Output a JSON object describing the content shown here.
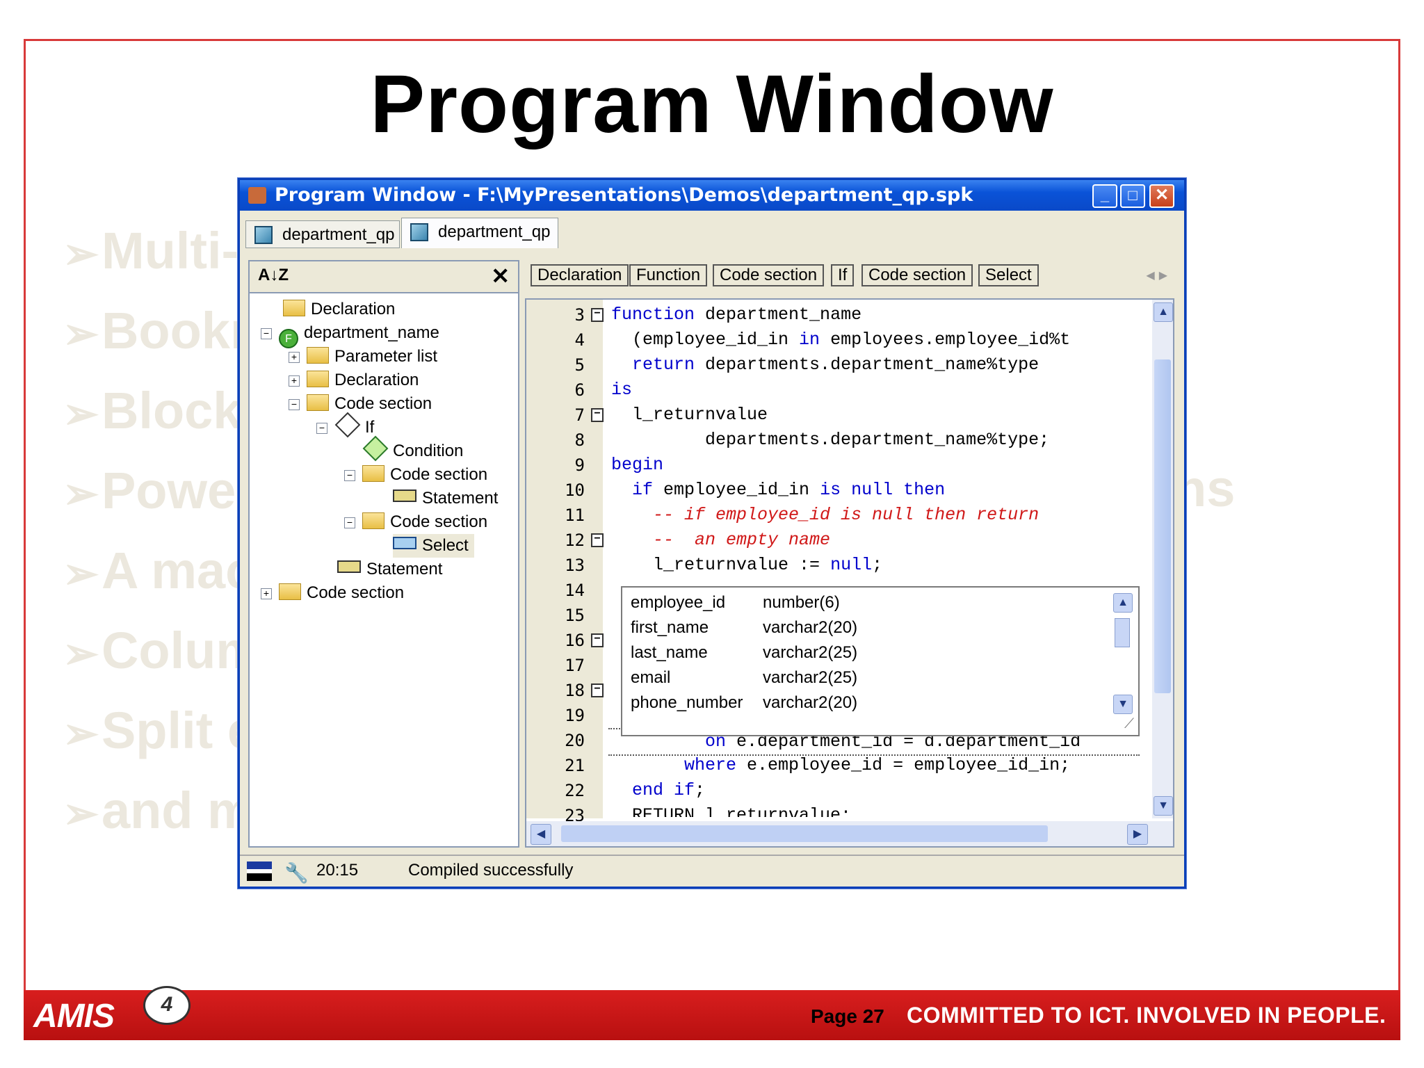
{
  "slide": {
    "title": "Program Window",
    "bullets": [
      "Multi-",
      "Bookm",
      "Block",
      "Power",
      "A mac",
      "Colum",
      "Split e",
      "and m"
    ],
    "bullet_tail": "ns"
  },
  "window": {
    "title": "Program Window - F:\\MyPresentations\\Demos\\department_qp.spk",
    "tabs": [
      {
        "label": "department_qp"
      },
      {
        "label": "department_qp"
      }
    ],
    "tree": [
      {
        "label": "Declaration"
      },
      {
        "label": "department_name"
      },
      {
        "label": "Parameter list"
      },
      {
        "label": "Declaration"
      },
      {
        "label": "Code section"
      },
      {
        "label": "If"
      },
      {
        "label": "Condition"
      },
      {
        "label": "Code section"
      },
      {
        "label": "Statement"
      },
      {
        "label": "Code section"
      },
      {
        "label": "Select"
      },
      {
        "label": "Statement"
      },
      {
        "label": "Code section"
      }
    ],
    "breadcrumb": [
      "Declaration",
      "Function",
      "Code section",
      "If",
      "Code section",
      "Select"
    ],
    "line_numbers": [
      "3",
      "4",
      "5",
      "6",
      "7",
      "8",
      "9",
      "10",
      "11",
      "12",
      "13",
      "14",
      "15",
      "16",
      "17",
      "18",
      "19",
      "20",
      "21",
      "22",
      "23"
    ],
    "code": {
      "l3a": "function",
      "l3b": " department_name",
      "l4a": "  (employee_id_in ",
      "l4b": "in",
      "l4c": " employees.employee_id%t",
      "l5a": "  return",
      "l5b": " departments.department_name%type",
      "l6": "is",
      "l7": "  l_returnvalue",
      "l8": "         departments.department_name%type;",
      "l9": "begin",
      "l10a": "  if",
      "l10b": " employee_id_in ",
      "l10c": "is null then",
      "l11": "    -- if employee_id is null then return",
      "l12": "    --  an empty name",
      "l13a": "    l_returnvalue := ",
      "l13b": "null",
      "l20a": "         on",
      "l20b": " e.department_id = d.department_id",
      "l21a": "       where",
      "l21b": " e.employee_id = employee_id_in;",
      "l22a": "  end if",
      "l22b": ";",
      "l23": "  RETURN l_returnvalue;"
    },
    "popup_rows": [
      {
        "name": "employee_id",
        "type": "number(6)"
      },
      {
        "name": "first_name",
        "type": "varchar2(20)"
      },
      {
        "name": "last_name",
        "type": "varchar2(25)"
      },
      {
        "name": "email",
        "type": "varchar2(25)"
      },
      {
        "name": "phone_number",
        "type": "varchar2(20)"
      }
    ],
    "status": {
      "position": "20:15",
      "message": "Compiled successfully"
    }
  },
  "footer": {
    "logo": "AMIS",
    "page": "Page 27",
    "slogan": "COMMITTED TO ICT.  INVOLVED IN PEOPLE."
  },
  "colors": {
    "accent": "#d81e1e",
    "keyword": "#0000cc",
    "comment": "#d01818",
    "titlebar": "#0a53d8"
  }
}
